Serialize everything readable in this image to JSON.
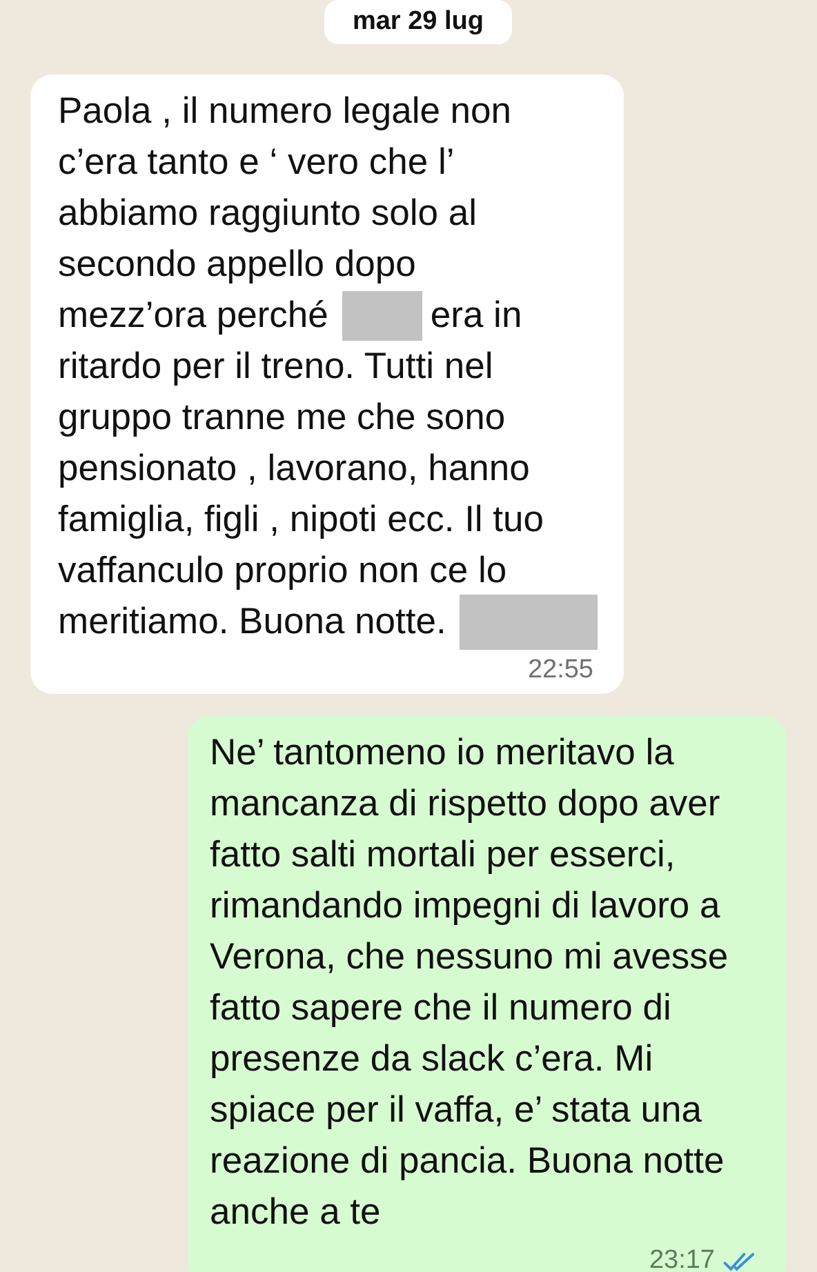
{
  "date_separator": "mar 29 lug",
  "messages": [
    {
      "kind": "incoming",
      "lines": [
        [
          {
            "kind": "text",
            "text": "Paola , il numero legale non"
          }
        ],
        [
          {
            "kind": "text",
            "text": "c’era tanto e ‘ vero che l’"
          }
        ],
        [
          {
            "kind": "text",
            "text": "abbiamo raggiunto solo al"
          }
        ],
        [
          {
            "kind": "text",
            "text": "secondo appello dopo"
          }
        ],
        [
          {
            "kind": "text",
            "text": "mezz’ora perché"
          },
          {
            "kind": "redacted"
          },
          {
            "kind": "text",
            "text": "era in"
          }
        ],
        [
          {
            "kind": "text",
            "text": "ritardo per il treno. Tutti nel"
          }
        ],
        [
          {
            "kind": "text",
            "text": "gruppo tranne me che sono"
          }
        ],
        [
          {
            "kind": "text",
            "text": "pensionato , lavorano, hanno"
          }
        ],
        [
          {
            "kind": "text",
            "text": "famiglia, figli , nipoti ecc. Il tuo"
          }
        ],
        [
          {
            "kind": "text",
            "text": "vaffanculo proprio non ce lo"
          }
        ],
        [
          {
            "kind": "text",
            "text": "meritiamo. Buona notte."
          },
          {
            "kind": "redacted"
          }
        ]
      ],
      "time": "22:55",
      "read": false
    },
    {
      "kind": "outgoing",
      "lines": [
        [
          {
            "kind": "text",
            "text": "Ne’ tantomeno io meritavo la"
          }
        ],
        [
          {
            "kind": "text",
            "text": "mancanza di rispetto dopo aver"
          }
        ],
        [
          {
            "kind": "text",
            "text": "fatto salti mortali per esserci,"
          }
        ],
        [
          {
            "kind": "text",
            "text": "rimandando impegni di lavoro a"
          }
        ],
        [
          {
            "kind": "text",
            "text": "Verona, che nessuno mi avesse"
          }
        ],
        [
          {
            "kind": "text",
            "text": "fatto sapere che il numero di"
          }
        ],
        [
          {
            "kind": "text",
            "text": "presenze da slack c’era. Mi"
          }
        ],
        [
          {
            "kind": "text",
            "text": "spiace per il vaffa, e’ stata una"
          }
        ],
        [
          {
            "kind": "text",
            "text": "reazione di pancia. Buona notte"
          }
        ],
        [
          {
            "kind": "text",
            "text": "anche a te"
          }
        ]
      ],
      "time": "23:17",
      "read": true
    }
  ]
}
